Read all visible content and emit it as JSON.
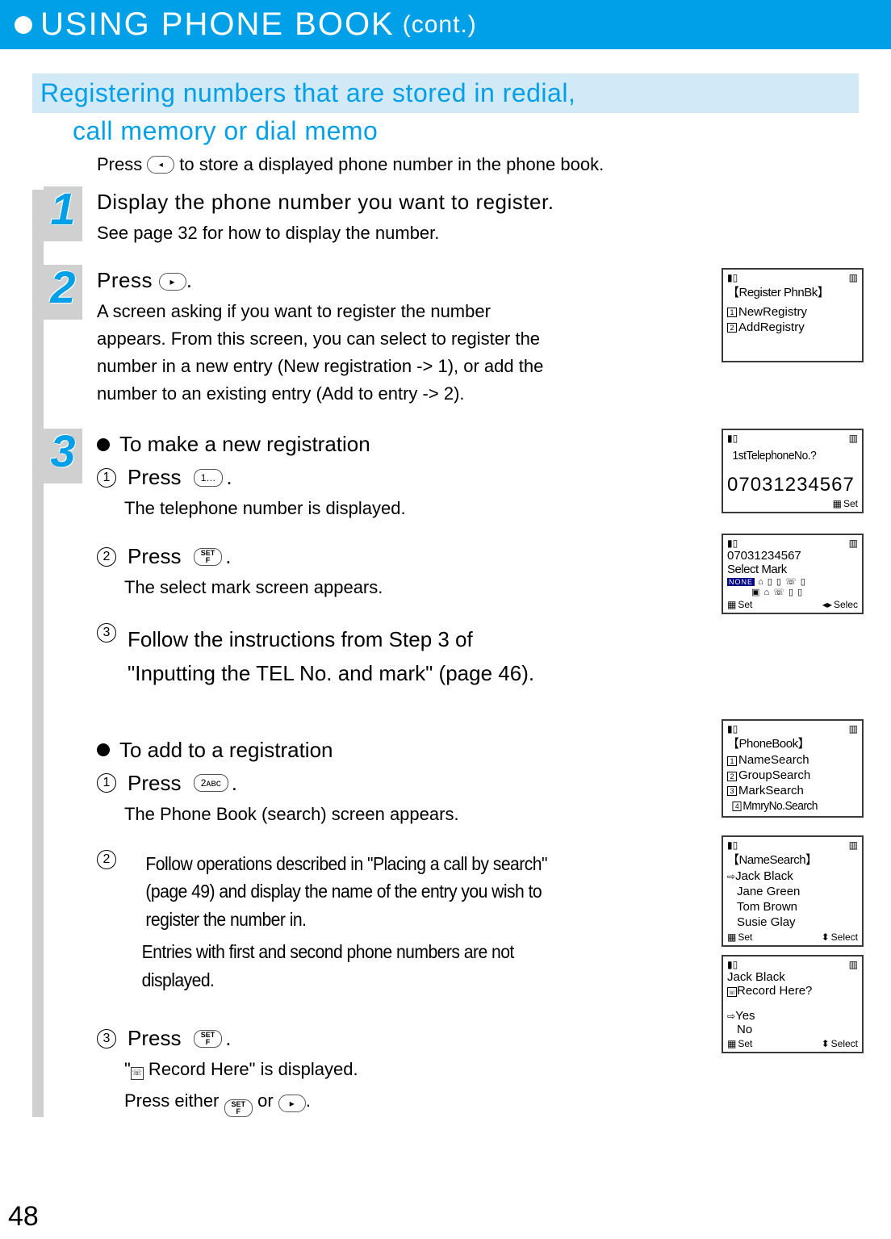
{
  "banner": {
    "title": "USING PHONE BOOK",
    "cont": "(cont.)"
  },
  "heading": {
    "line1": "Registering numbers that are stored in redial,",
    "line2": "call memory or dial memo"
  },
  "intro": {
    "pre": "Press",
    "post": "to store a displayed phone number in the phone book."
  },
  "step1": {
    "num": "1",
    "title": "Display the phone number you want to register.",
    "sub": "See page 32 for how to display the number."
  },
  "step2": {
    "num": "2",
    "title_pre": "Press",
    "title_post": ".",
    "sub": "A screen asking if you want to register the number appears. From this screen, you can select to register the number in a new entry (New registration -> 1), or add the number to an existing entry (Add to entry -> 2)."
  },
  "step3": {
    "num": "3",
    "a_title": "To make a new registration",
    "a1_pre": "Press",
    "a1_post": ".",
    "a1_sub": "The telephone number is displayed.",
    "a2_pre": "Press",
    "a2_post": ".",
    "a2_sub": "The select mark screen appears.",
    "a3": "Follow the instructions from Step 3 of \"Inputting the TEL No. and mark\" (page 46).",
    "b_title": "To add to a registration",
    "b1_pre": "Press",
    "b1_post": ".",
    "b1_sub": "The Phone Book (search) screen appears.",
    "b2_main": "Follow operations described in \"Placing a call by search\" (page 49) and display the name of the entry you wish to register the number in.",
    "b2_sub": "Entries with first and second phone numbers are not displayed.",
    "b3_pre": "Press",
    "b3_post": ".",
    "b3_sub_pre": "\"",
    "b3_sub_mid": " Record Here\" is displayed.",
    "b3_sub2_pre": "Press either ",
    "b3_sub2_mid": " or ",
    "b3_sub2_post": "."
  },
  "circles": {
    "c1": "1",
    "c2": "2",
    "c3": "3"
  },
  "keys": {
    "one": "1…",
    "two": "2ᴀʙᴄ",
    "set_top": "SET",
    "set_bot": "F",
    "arrow_left": "◂",
    "arrow_right": "▸"
  },
  "screens": {
    "s1": {
      "title": "【Register PhnBk】",
      "i1": "NewRegistry",
      "i2": "AddRegistry",
      "n1": "1",
      "n2": "2"
    },
    "s2": {
      "title": "1stTelephoneNo.?",
      "number": "07031234567",
      "foot": "Set"
    },
    "s3": {
      "number": "07031234567",
      "title": "Select Mark",
      "none": "NONE",
      "foot_l": "Set",
      "foot_r": "Selec"
    },
    "s4": {
      "title": "【PhoneBook】",
      "i1": "NameSearch",
      "i2": "GroupSearch",
      "i3": "MarkSearch",
      "i4": "MmryNo.Search",
      "n1": "1",
      "n2": "2",
      "n3": "3",
      "n4": "4"
    },
    "s5": {
      "title": "【NameSearch】",
      "sel": "Jack Black",
      "i2": "Jane Green",
      "i3": "Tom Brown",
      "i4": "Susie Glay",
      "foot_l": "Set",
      "foot_r": "Select"
    },
    "s6": {
      "name": "Jack Black",
      "q": "Record Here?",
      "yes": "Yes",
      "no": "No",
      "foot_l": "Set",
      "foot_r": "Select"
    }
  },
  "page": "48"
}
